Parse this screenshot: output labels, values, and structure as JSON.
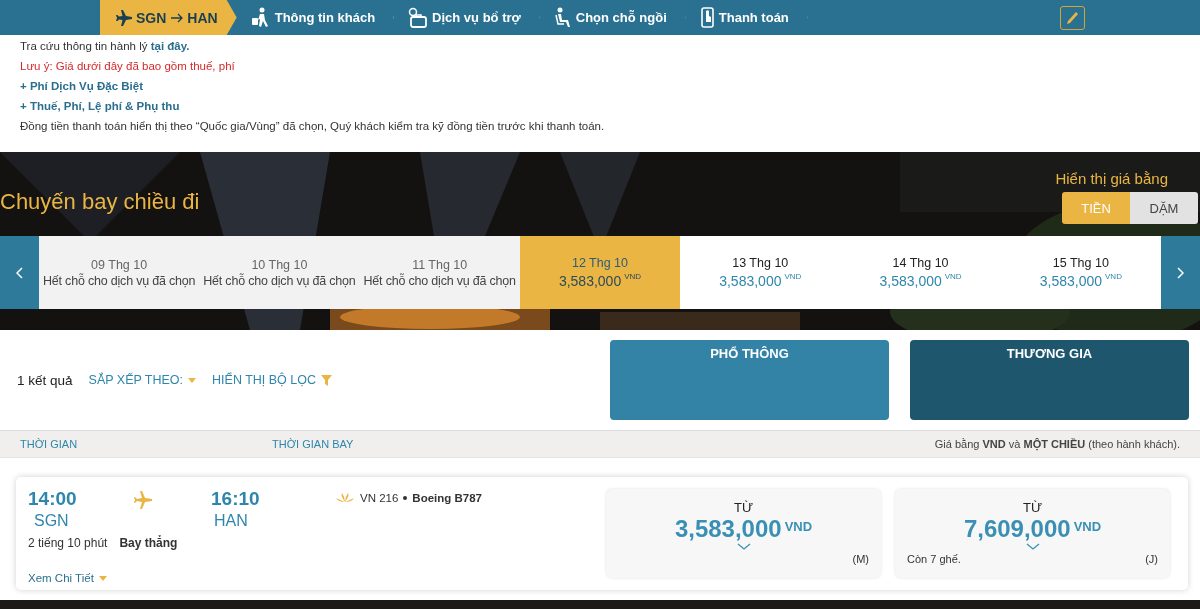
{
  "steps": [
    {
      "label": "SGN",
      "label_to": "HAN",
      "selected": true
    },
    {
      "label": "Thông tin khách",
      "selected": false
    },
    {
      "label": "Dịch vụ bổ trợ",
      "selected": false
    },
    {
      "label": "Chọn chỗ ngồi",
      "selected": false
    },
    {
      "label": "Thanh toán",
      "selected": false
    }
  ],
  "notes": [
    {
      "text": "Tra cứu thông tin hành lý ",
      "link": "tại đây.",
      "kind": "plain"
    },
    {
      "text": "Lưu ý: Giá dưới đây đã bao gồm thuế, phí",
      "kind": "warning"
    },
    {
      "text": "+ Phí Dịch Vụ Đặc Biệt",
      "kind": "link"
    },
    {
      "text": "+ Thuế, Phí, Lệ phí & Phụ thu",
      "kind": "link"
    },
    {
      "text": "Đồng tiền thanh toán hiển thị theo “Quốc gia/Vùng” đã chọn, Quý khách kiểm tra kỹ đồng tiền trước khi thanh toán.",
      "kind": "plain"
    }
  ],
  "heading": "Chuyến bay chiều đi",
  "price_toggle": {
    "label": "Hiển thị giá bằng",
    "options": [
      {
        "label": "TIỀN",
        "selected": true
      },
      {
        "label": "DẶM",
        "selected": false
      }
    ]
  },
  "dates": [
    {
      "date": "09 Thg 10",
      "available": false,
      "message": "Hết chỗ cho dịch vụ đã chọn",
      "selected": false
    },
    {
      "date": "10 Thg 10",
      "available": false,
      "message": "Hết chỗ cho dịch vụ đã chọn",
      "selected": false
    },
    {
      "date": "11 Thg 10",
      "available": false,
      "message": "Hết chỗ cho dịch vụ đã chọn",
      "selected": false
    },
    {
      "date": "12 Thg 10",
      "available": true,
      "price": "3,583,000",
      "currency": "VND",
      "selected": true
    },
    {
      "date": "13 Thg 10",
      "available": true,
      "price": "3,583,000",
      "currency": "VND",
      "selected": false
    },
    {
      "date": "14 Thg 10",
      "available": true,
      "price": "3,583,000",
      "currency": "VND",
      "selected": false
    },
    {
      "date": "15 Thg 10",
      "available": true,
      "price": "3,583,000",
      "currency": "VND",
      "selected": false
    }
  ],
  "results": {
    "count": "1 kết quả",
    "sort": "SẮP XẾP THEO:",
    "filter": "HIỂN THỊ BỘ LỌC"
  },
  "cabins": [
    {
      "label": "PHỔ THÔNG",
      "color": "#3383a6"
    },
    {
      "label": "THƯƠNG GIA",
      "color": "#1e566e"
    }
  ],
  "columns": {
    "column_1": "THỜI GIAN",
    "column_2": "THỜI GIAN BAY",
    "price_note": "Giá bằng **VND** và **MỘT CHIỀU** (theo hành khách)."
  },
  "flight": {
    "departure_time": "14:00",
    "departure_airport": "SGN",
    "arrival_time": "16:10",
    "arrival_airport": "HAN",
    "duration": "2 tiếng 10 phút",
    "stops": "Bay thẳng",
    "flight_number": "VN 216",
    "aircraft": "Boeing B787",
    "details_link": "Xem Chi Tiết",
    "fares": [
      {
        "prefix": "TỪ",
        "amount": "3,583,000",
        "currency": "VND",
        "class": "(M)"
      },
      {
        "prefix": "TỪ",
        "amount": "7,609,000",
        "currency": "VND",
        "seats": "Còn 7 ghế.",
        "class": "(J)"
      }
    ]
  }
}
